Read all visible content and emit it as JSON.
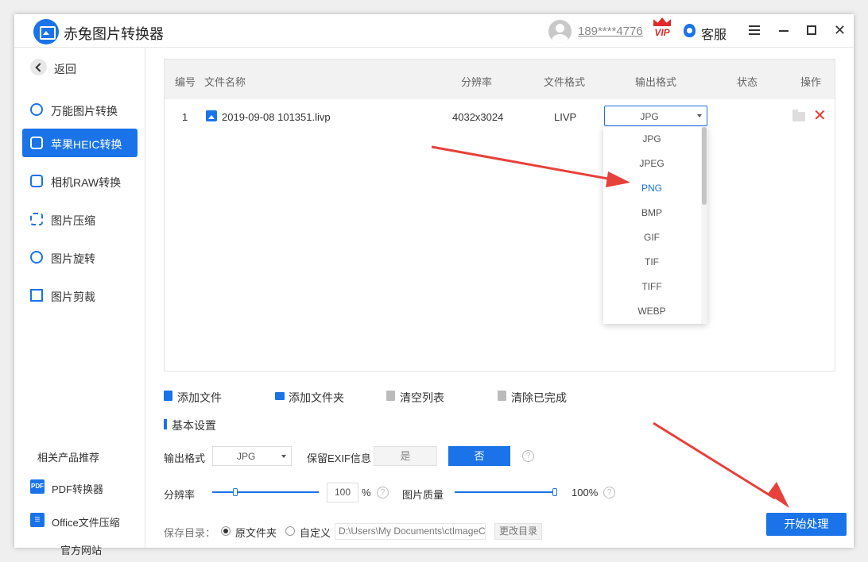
{
  "app": {
    "title": "赤兔图片转换器",
    "username": "189****4776",
    "vip": "VIP",
    "service": "客服"
  },
  "sidebar": {
    "back": "返回",
    "items": [
      {
        "label": "万能图片转换",
        "active": false
      },
      {
        "label": "苹果HEIC转换",
        "active": true
      },
      {
        "label": "相机RAW转换",
        "active": false
      },
      {
        "label": "图片压缩",
        "active": false
      },
      {
        "label": "图片旋转",
        "active": false
      },
      {
        "label": "图片剪裁",
        "active": false
      }
    ],
    "recommend_title": "相关产品推荐",
    "recommend": [
      {
        "label": "PDF转换器",
        "icon": "PDF"
      },
      {
        "label": "Office文件压缩",
        "icon": "office-icon"
      }
    ],
    "website": "官方网站"
  },
  "table": {
    "headers": [
      "编号",
      "文件名称",
      "分辨率",
      "文件格式",
      "输出格式",
      "状态",
      "操作"
    ],
    "rows": [
      {
        "no": "1",
        "name": "2019-09-08 101351.livp",
        "resolution": "4032x3024",
        "format": "LIVP",
        "output": "JPG",
        "status": ""
      }
    ]
  },
  "dropdown": {
    "options": [
      "JPG",
      "JPEG",
      "PNG",
      "BMP",
      "GIF",
      "TIF",
      "TIFF",
      "WEBP"
    ],
    "highlighted": "PNG"
  },
  "toolbar": {
    "add_file": "添加文件",
    "add_folder": "添加文件夹",
    "clear_list": "清空列表",
    "clear_done": "清除已完成"
  },
  "settings": {
    "section_title": "基本设置",
    "output_format_label": "输出格式",
    "output_format_value": "JPG",
    "exif_label": "保留EXIF信息",
    "exif_yes": "是",
    "exif_no": "否",
    "resolution_label": "分辨率",
    "resolution_value": "100",
    "resolution_unit": "%",
    "quality_label": "图片质量",
    "quality_value": "100%",
    "save_dir_label": "保存目录：",
    "original_folder": "原文件夹",
    "custom": "自定义",
    "path": "D:\\Users\\My Documents\\ctImageC",
    "change_dir": "更改目录"
  },
  "start_button": "开始处理",
  "colors": {
    "accent": "#1a73e8",
    "danger": "#e53935",
    "arrow": "#e8403a"
  }
}
